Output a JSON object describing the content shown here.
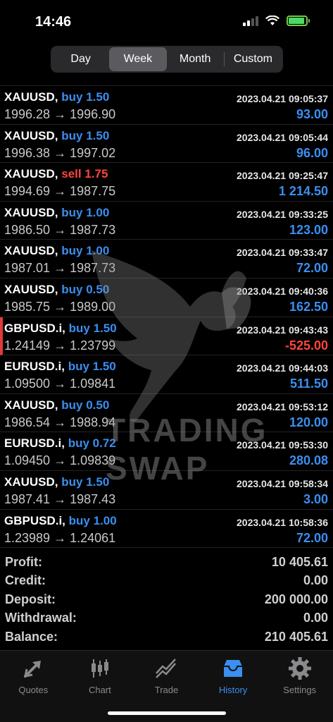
{
  "status": {
    "time": "14:46"
  },
  "periods": {
    "options": [
      "Day",
      "Week",
      "Month",
      "Custom"
    ],
    "selected": "Week"
  },
  "deals": [
    {
      "symbol": "XAUUSD,",
      "side": "buy",
      "volume": "1.50",
      "time": "2023.04.21 09:05:37",
      "open": "1996.28",
      "close": "1996.90",
      "profit": "93.00",
      "profit_sign": "pos"
    },
    {
      "symbol": "XAUUSD,",
      "side": "buy",
      "volume": "1.50",
      "time": "2023.04.21 09:05:44",
      "open": "1996.38",
      "close": "1997.02",
      "profit": "96.00",
      "profit_sign": "pos"
    },
    {
      "symbol": "XAUUSD,",
      "side": "sell",
      "volume": "1.75",
      "time": "2023.04.21 09:25:47",
      "open": "1994.69",
      "close": "1987.75",
      "profit": "1 214.50",
      "profit_sign": "pos"
    },
    {
      "symbol": "XAUUSD,",
      "side": "buy",
      "volume": "1.00",
      "time": "2023.04.21 09:33:25",
      "open": "1986.50",
      "close": "1987.73",
      "profit": "123.00",
      "profit_sign": "pos"
    },
    {
      "symbol": "XAUUSD,",
      "side": "buy",
      "volume": "1.00",
      "time": "2023.04.21 09:33:47",
      "open": "1987.01",
      "close": "1987.73",
      "profit": "72.00",
      "profit_sign": "pos"
    },
    {
      "symbol": "XAUUSD,",
      "side": "buy",
      "volume": "0.50",
      "time": "2023.04.21 09:40:36",
      "open": "1985.75",
      "close": "1989.00",
      "profit": "162.50",
      "profit_sign": "pos"
    },
    {
      "symbol": "GBPUSD.i,",
      "side": "buy",
      "volume": "1.50",
      "time": "2023.04.21 09:43:43",
      "open": "1.24149",
      "close": "1.23799",
      "profit": "-525.00",
      "profit_sign": "neg"
    },
    {
      "symbol": "EURUSD.i,",
      "side": "buy",
      "volume": "1.50",
      "time": "2023.04.21 09:44:03",
      "open": "1.09500",
      "close": "1.09841",
      "profit": "511.50",
      "profit_sign": "pos"
    },
    {
      "symbol": "XAUUSD,",
      "side": "buy",
      "volume": "0.50",
      "time": "2023.04.21 09:53:12",
      "open": "1986.54",
      "close": "1988.94",
      "profit": "120.00",
      "profit_sign": "pos"
    },
    {
      "symbol": "EURUSD.i,",
      "side": "buy",
      "volume": "0.72",
      "time": "2023.04.21 09:53:30",
      "open": "1.09450",
      "close": "1.09839",
      "profit": "280.08",
      "profit_sign": "pos"
    },
    {
      "symbol": "XAUUSD,",
      "side": "buy",
      "volume": "1.50",
      "time": "2023.04.21 09:58:34",
      "open": "1987.41",
      "close": "1987.43",
      "profit": "3.00",
      "profit_sign": "pos"
    },
    {
      "symbol": "GBPUSD.i,",
      "side": "buy",
      "volume": "1.00",
      "time": "2023.04.21 10:58:36",
      "open": "1.23989",
      "close": "1.24061",
      "profit": "72.00",
      "profit_sign": "pos"
    }
  ],
  "arrow": "→",
  "summary": [
    {
      "label": "Profit:",
      "value": "10 405.61"
    },
    {
      "label": "Credit:",
      "value": "0.00"
    },
    {
      "label": "Deposit:",
      "value": "200 000.00"
    },
    {
      "label": "Withdrawal:",
      "value": "0.00"
    },
    {
      "label": "Balance:",
      "value": "210 405.61"
    }
  ],
  "watermark": "TRADING SWAP",
  "tabs": [
    {
      "label": "Quotes",
      "icon": "quotes-icon"
    },
    {
      "label": "Chart",
      "icon": "chart-icon"
    },
    {
      "label": "Trade",
      "icon": "trade-icon"
    },
    {
      "label": "History",
      "icon": "history-icon",
      "active": true
    },
    {
      "label": "Settings",
      "icon": "settings-icon"
    }
  ],
  "colors": {
    "accent": "#3a8ff0",
    "sell": "#ff453a",
    "loss": "#ff453a",
    "background": "#000000"
  }
}
